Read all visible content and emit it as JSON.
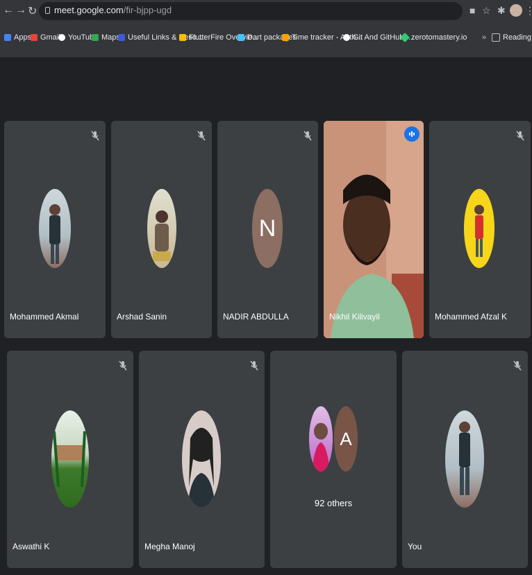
{
  "browser": {
    "url_host": "meet.google.com",
    "url_path": "/fir-bjpp-ugd",
    "bookmarks": [
      {
        "label": "Apps",
        "icon": "apps-grid-icon",
        "color": "#4285f4"
      },
      {
        "label": "Gmail",
        "icon": "gmail-icon",
        "color": "#ea4335"
      },
      {
        "label": "YouTube",
        "icon": "youtube-icon",
        "color": "#ffffff"
      },
      {
        "label": "Maps",
        "icon": "maps-icon",
        "color": "#34a853"
      },
      {
        "label": "Useful Links & Reso...",
        "icon": "doc-icon",
        "color": "#3b5bdb"
      },
      {
        "label": "FlutterFire Overvie...",
        "icon": "flutterfire-icon",
        "color": "#fbbc04"
      },
      {
        "label": "Dart packages",
        "icon": "dart-icon",
        "color": "#40c4ff"
      },
      {
        "label": "Time tracker - Auth...",
        "icon": "flame-icon",
        "color": "#ffa000"
      },
      {
        "label": "Git And GitHub -...",
        "icon": "github-icon",
        "color": "#ffffff"
      },
      {
        "label": "zerotomastery.io",
        "icon": "ztm-icon",
        "color": "#2ecc71"
      },
      {
        "label": "Reading list",
        "icon": "reading-list-icon",
        "color": "#bdc1c6"
      }
    ]
  },
  "meet": {
    "participants_row1": [
      {
        "name": "Mohammed Akmal",
        "avatar": "photo",
        "muted": true
      },
      {
        "name": "Arshad Sanin",
        "avatar": "photo",
        "muted": true
      },
      {
        "name": "NADIR ABDULLA",
        "avatar": "letter",
        "letter": "N",
        "muted": true
      },
      {
        "name": "Nikhil Kilivayil",
        "avatar": "video",
        "speaking": true
      },
      {
        "name": "Mohammed Afzal K",
        "avatar": "photo",
        "muted": true
      }
    ],
    "participants_row2": [
      {
        "name": "Aswathi K",
        "avatar": "photo",
        "muted": true
      },
      {
        "name": "Megha Manoj",
        "avatar": "photo",
        "muted": true
      },
      {
        "name": "",
        "others_count_label": "92 others",
        "letter": "A"
      },
      {
        "name": "You",
        "avatar": "photo",
        "muted": true
      }
    ]
  },
  "colors": {
    "speaking_outline": "#8ab4f8",
    "avatar_n": "#8d6e63",
    "avatar_a": "#795548"
  }
}
